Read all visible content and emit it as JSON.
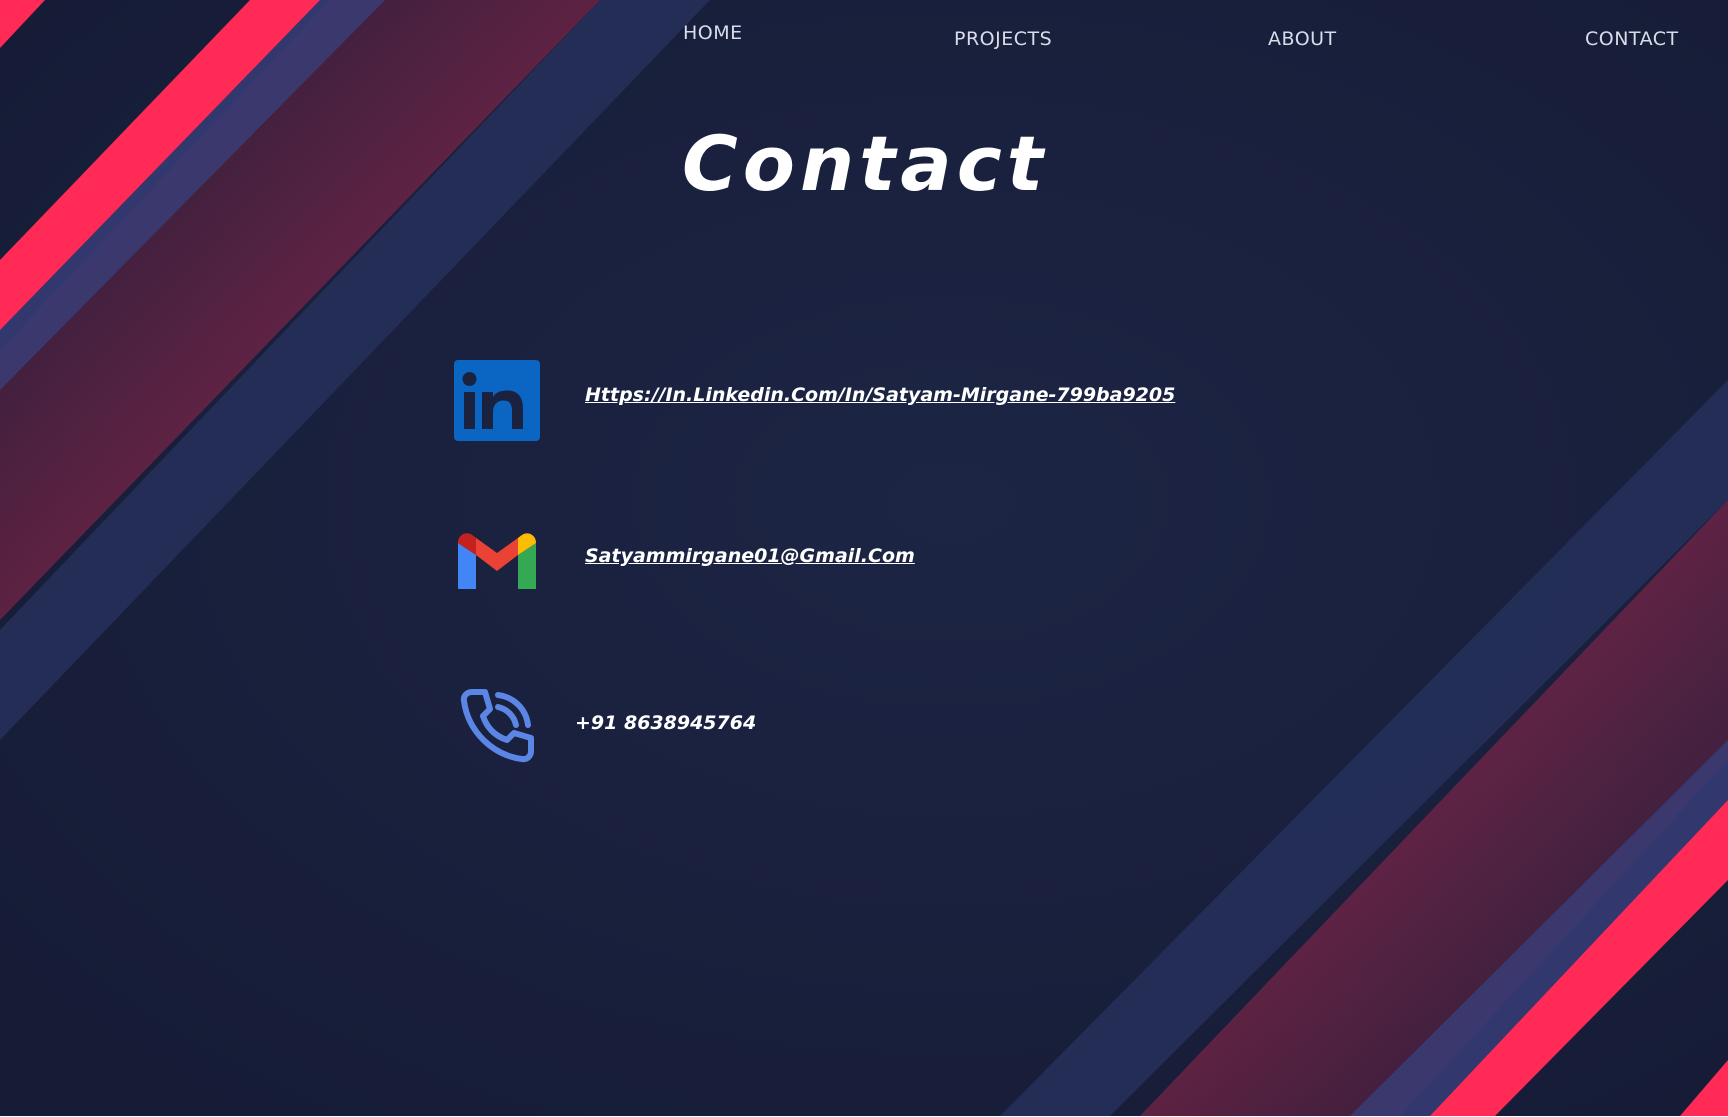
{
  "nav": {
    "items": [
      {
        "label": "HOME"
      },
      {
        "label": "PROJECTS"
      },
      {
        "label": "ABOUT"
      },
      {
        "label": "CONTACT"
      }
    ]
  },
  "main": {
    "title": "Contact",
    "contacts": [
      {
        "icon": "linkedin-icon",
        "text": "Https://In.Linkedin.Com/In/Satyam-Mirgane-799ba9205"
      },
      {
        "icon": "gmail-icon",
        "text": "Satyammirgane01@Gmail.Com"
      },
      {
        "icon": "phone-icon",
        "text": "+91 8638945764"
      }
    ]
  },
  "colors": {
    "background": "#1b2240",
    "accent_pink": "#ff2a55",
    "stripe_blue": "#2a3561",
    "linkedin_blue": "#0a66c2",
    "phone_icon": "#5b86e5",
    "text": "#ffffff",
    "nav_text": "#d9dcea"
  }
}
